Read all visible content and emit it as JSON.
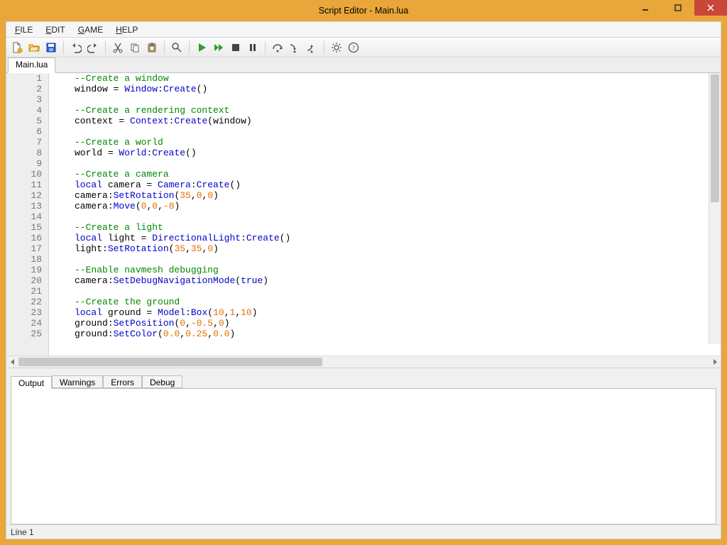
{
  "title": "Script Editor - Main.lua",
  "menu": {
    "file": "FILE",
    "edit": "EDIT",
    "game": "GAME",
    "help": "HELP"
  },
  "toolbar": {
    "new": "new",
    "open": "open",
    "save": "save",
    "undo": "undo",
    "redo": "redo",
    "cut": "cut",
    "copy": "copy",
    "paste": "paste",
    "find": "find",
    "run": "run",
    "run_fast": "run-fast",
    "stop": "stop",
    "pause": "pause",
    "step_over": "step-over",
    "step_into": "step-into",
    "step_out": "step-out",
    "settings": "settings",
    "help": "help"
  },
  "file_tabs": {
    "items": [
      {
        "label": "Main.lua"
      }
    ]
  },
  "editor": {
    "lines": [
      {
        "n": 1,
        "tokens": [
          [
            "comment",
            "--Create a window"
          ]
        ]
      },
      {
        "n": 2,
        "tokens": [
          [
            "ident",
            "window "
          ],
          [
            "punct",
            "= "
          ],
          [
            "global",
            "Window"
          ],
          [
            "punct",
            ":"
          ],
          [
            "func",
            "Create"
          ],
          [
            "punct",
            "()"
          ]
        ]
      },
      {
        "n": 3,
        "tokens": []
      },
      {
        "n": 4,
        "tokens": [
          [
            "comment",
            "--Create a rendering context"
          ]
        ]
      },
      {
        "n": 5,
        "tokens": [
          [
            "ident",
            "context "
          ],
          [
            "punct",
            "= "
          ],
          [
            "global",
            "Context"
          ],
          [
            "punct",
            ":"
          ],
          [
            "func",
            "Create"
          ],
          [
            "punct",
            "("
          ],
          [
            "ident",
            "window"
          ],
          [
            "punct",
            ")"
          ]
        ]
      },
      {
        "n": 6,
        "tokens": []
      },
      {
        "n": 7,
        "tokens": [
          [
            "comment",
            "--Create a world"
          ]
        ]
      },
      {
        "n": 8,
        "tokens": [
          [
            "ident",
            "world "
          ],
          [
            "punct",
            "= "
          ],
          [
            "global",
            "World"
          ],
          [
            "punct",
            ":"
          ],
          [
            "func",
            "Create"
          ],
          [
            "punct",
            "()"
          ]
        ]
      },
      {
        "n": 9,
        "tokens": []
      },
      {
        "n": 10,
        "tokens": [
          [
            "comment",
            "--Create a camera"
          ]
        ]
      },
      {
        "n": 11,
        "tokens": [
          [
            "keyword",
            "local "
          ],
          [
            "ident",
            "camera "
          ],
          [
            "punct",
            "= "
          ],
          [
            "global",
            "Camera"
          ],
          [
            "punct",
            ":"
          ],
          [
            "func",
            "Create"
          ],
          [
            "punct",
            "()"
          ]
        ]
      },
      {
        "n": 12,
        "tokens": [
          [
            "ident",
            "camera"
          ],
          [
            "punct",
            ":"
          ],
          [
            "func",
            "SetRotation"
          ],
          [
            "punct",
            "("
          ],
          [
            "number",
            "35"
          ],
          [
            "punct",
            ","
          ],
          [
            "number",
            "0"
          ],
          [
            "punct",
            ","
          ],
          [
            "number",
            "0"
          ],
          [
            "punct",
            ")"
          ]
        ]
      },
      {
        "n": 13,
        "tokens": [
          [
            "ident",
            "camera"
          ],
          [
            "punct",
            ":"
          ],
          [
            "func",
            "Move"
          ],
          [
            "punct",
            "("
          ],
          [
            "number",
            "0"
          ],
          [
            "punct",
            ","
          ],
          [
            "number",
            "0"
          ],
          [
            "punct",
            ","
          ],
          [
            "number",
            "-8"
          ],
          [
            "punct",
            ")"
          ]
        ]
      },
      {
        "n": 14,
        "tokens": []
      },
      {
        "n": 15,
        "tokens": [
          [
            "comment",
            "--Create a light"
          ]
        ]
      },
      {
        "n": 16,
        "tokens": [
          [
            "keyword",
            "local "
          ],
          [
            "ident",
            "light "
          ],
          [
            "punct",
            "= "
          ],
          [
            "global",
            "DirectionalLight"
          ],
          [
            "punct",
            ":"
          ],
          [
            "func",
            "Create"
          ],
          [
            "punct",
            "()"
          ]
        ]
      },
      {
        "n": 17,
        "tokens": [
          [
            "ident",
            "light"
          ],
          [
            "punct",
            ":"
          ],
          [
            "func",
            "SetRotation"
          ],
          [
            "punct",
            "("
          ],
          [
            "number",
            "35"
          ],
          [
            "punct",
            ","
          ],
          [
            "number",
            "35"
          ],
          [
            "punct",
            ","
          ],
          [
            "number",
            "0"
          ],
          [
            "punct",
            ")"
          ]
        ]
      },
      {
        "n": 18,
        "tokens": []
      },
      {
        "n": 19,
        "tokens": [
          [
            "comment",
            "--Enable navmesh debugging"
          ]
        ]
      },
      {
        "n": 20,
        "tokens": [
          [
            "ident",
            "camera"
          ],
          [
            "punct",
            ":"
          ],
          [
            "func",
            "SetDebugNavigationMode"
          ],
          [
            "punct",
            "("
          ],
          [
            "bool",
            "true"
          ],
          [
            "punct",
            ")"
          ]
        ]
      },
      {
        "n": 21,
        "tokens": []
      },
      {
        "n": 22,
        "tokens": [
          [
            "comment",
            "--Create the ground"
          ]
        ]
      },
      {
        "n": 23,
        "tokens": [
          [
            "keyword",
            "local "
          ],
          [
            "ident",
            "ground "
          ],
          [
            "punct",
            "= "
          ],
          [
            "global",
            "Model"
          ],
          [
            "punct",
            ":"
          ],
          [
            "func",
            "Box"
          ],
          [
            "punct",
            "("
          ],
          [
            "number",
            "10"
          ],
          [
            "punct",
            ","
          ],
          [
            "number",
            "1"
          ],
          [
            "punct",
            ","
          ],
          [
            "number",
            "10"
          ],
          [
            "punct",
            ")"
          ]
        ]
      },
      {
        "n": 24,
        "tokens": [
          [
            "ident",
            "ground"
          ],
          [
            "punct",
            ":"
          ],
          [
            "func",
            "SetPosition"
          ],
          [
            "punct",
            "("
          ],
          [
            "number",
            "0"
          ],
          [
            "punct",
            ","
          ],
          [
            "number",
            "-0.5"
          ],
          [
            "punct",
            ","
          ],
          [
            "number",
            "0"
          ],
          [
            "punct",
            ")"
          ]
        ]
      },
      {
        "n": 25,
        "tokens": [
          [
            "ident",
            "ground"
          ],
          [
            "punct",
            ":"
          ],
          [
            "func",
            "SetColor"
          ],
          [
            "punct",
            "("
          ],
          [
            "number",
            "0.0"
          ],
          [
            "punct",
            ","
          ],
          [
            "number",
            "0.25"
          ],
          [
            "punct",
            ","
          ],
          [
            "number",
            "0.0"
          ],
          [
            "punct",
            ")"
          ]
        ]
      }
    ]
  },
  "lower_tabs": {
    "items": [
      {
        "label": "Output",
        "active": true
      },
      {
        "label": "Warnings",
        "active": false
      },
      {
        "label": "Errors",
        "active": false
      },
      {
        "label": "Debug",
        "active": false
      }
    ]
  },
  "status": {
    "left": "Line 1"
  }
}
